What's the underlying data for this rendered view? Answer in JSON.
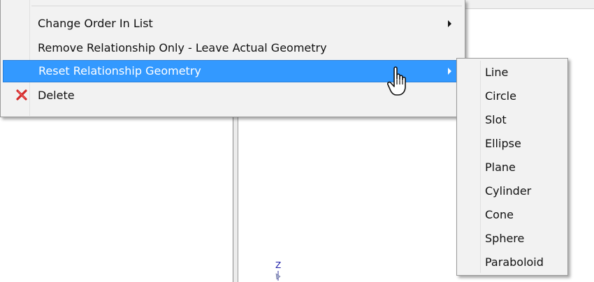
{
  "context_menu": {
    "items": [
      {
        "label": "Change Order In List",
        "has_submenu": true
      },
      {
        "label": "Remove Relationship Only - Leave Actual Geometry",
        "has_submenu": false
      },
      {
        "label": "Reset Relationship Geometry",
        "has_submenu": true,
        "highlighted": true
      },
      {
        "label": "Delete",
        "has_submenu": false,
        "icon": "delete-x-icon"
      }
    ],
    "highlight_color": "#3399ff",
    "delete_icon_color": "#d42a2a"
  },
  "submenu": {
    "items": [
      {
        "label": "Line"
      },
      {
        "label": "Circle"
      },
      {
        "label": "Slot"
      },
      {
        "label": "Ellipse"
      },
      {
        "label": "Plane"
      },
      {
        "label": "Cylinder"
      },
      {
        "label": "Cone"
      },
      {
        "label": "Sphere"
      },
      {
        "label": "Paraboloid"
      }
    ]
  },
  "viewport": {
    "axis_label": "Z"
  },
  "cursor": {
    "type": "hand-pointer-icon"
  }
}
